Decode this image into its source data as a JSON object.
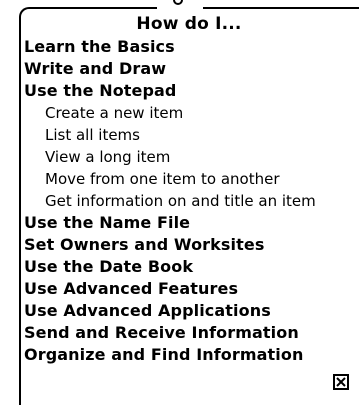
{
  "dialog": {
    "title": "How do I..."
  },
  "topics": [
    {
      "label": "Learn the Basics",
      "level": 0
    },
    {
      "label": "Write and Draw",
      "level": 0
    },
    {
      "label": "Use the Notepad",
      "level": 0
    },
    {
      "label": "Create a new item",
      "level": 1
    },
    {
      "label": "List all items",
      "level": 1
    },
    {
      "label": "View a long item",
      "level": 1
    },
    {
      "label": "Move from one item to another",
      "level": 1
    },
    {
      "label": "Get information on and title an item",
      "level": 1
    },
    {
      "label": "Use the Name File",
      "level": 0
    },
    {
      "label": "Set Owners and Worksites",
      "level": 0
    },
    {
      "label": "Use the Date Book",
      "level": 0
    },
    {
      "label": "Use Advanced Features",
      "level": 0
    },
    {
      "label": "Use Advanced Applications",
      "level": 0
    },
    {
      "label": "Send and Receive Information",
      "level": 0
    },
    {
      "label": "Organize and Find Information",
      "level": 0
    }
  ],
  "icons": {
    "close": "close-box-icon"
  }
}
